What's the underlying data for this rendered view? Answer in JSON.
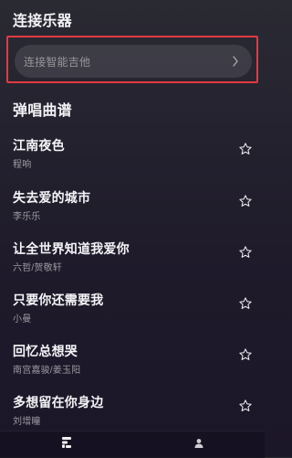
{
  "sections": {
    "connect_title": "连接乐器",
    "songs_title": "弹唱曲谱"
  },
  "connect": {
    "label": "连接智能吉他"
  },
  "songs": [
    {
      "title": "江南夜色",
      "artist": "程响"
    },
    {
      "title": "失去爱的城市",
      "artist": "李乐乐"
    },
    {
      "title": "让全世界知道我爱你",
      "artist": "六哲/贺敬轩"
    },
    {
      "title": "只要你还需要我",
      "artist": "小曼"
    },
    {
      "title": "回忆总想哭",
      "artist": "南宫嘉骏/姜玉阳"
    },
    {
      "title": "多想留在你身边",
      "artist": "刘增瞳"
    }
  ],
  "icons": {
    "favorite": "star-outline-icon",
    "connect_arrow": "chevron-right-icon",
    "tab_home": "app-logo-icon",
    "tab_profile": "person-icon"
  },
  "colors": {
    "highlight_border": "#e23a44"
  }
}
